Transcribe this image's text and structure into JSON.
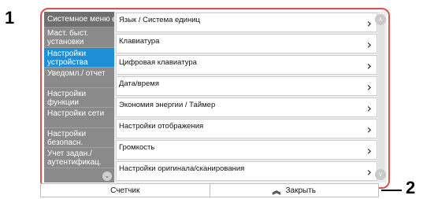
{
  "callouts": {
    "one": "1",
    "two": "2"
  },
  "sidebar": {
    "header": "Системное меню",
    "items": [
      {
        "label": "Маст. быст. установки",
        "active": false
      },
      {
        "label": "Настройки устройства",
        "active": true
      },
      {
        "label": "Уведомл./ отчет",
        "active": false
      },
      {
        "label": "Настройки функции",
        "active": false
      },
      {
        "label": "Настройки сети",
        "active": false
      },
      {
        "label": "Настройки безопасн.",
        "active": false
      },
      {
        "label": "Учет задан./ аутентификац.",
        "active": false
      }
    ]
  },
  "list": {
    "items": [
      "Язык / Система единиц",
      "Клавиатура",
      "Цифровая клавиатура",
      "Дата/время",
      "Экономия энергии / Таймер",
      "Настройки отображения",
      "Громкость",
      "Настройки оригинала/сканирования"
    ]
  },
  "bottom_bar": {
    "counter_label": "Счетчик",
    "close_label": "Закрыть"
  },
  "colors": {
    "frame_border": "#e0504c",
    "sidebar_bg": "#8a8a8a",
    "active_item": "#1e8fd6"
  }
}
